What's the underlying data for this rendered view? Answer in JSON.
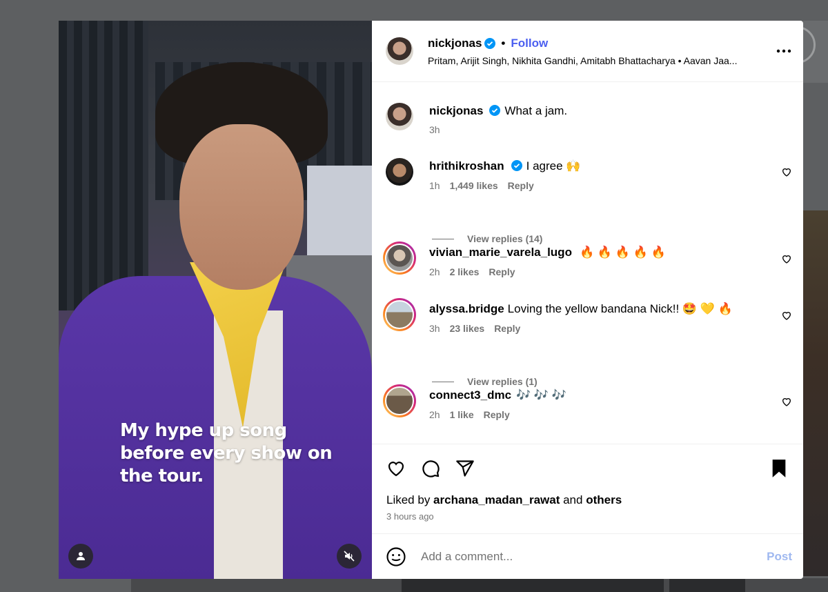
{
  "post": {
    "author": "nickjonas",
    "follow_label": "Follow",
    "dot": "•",
    "audio": "Pritam, Arijit Singh, Nikhita Gandhi, Amitabh Bhattacharya • Aavan Jaa...",
    "overlay_caption": "My hype up song before every show on the tour."
  },
  "caption": {
    "author": "nickjonas",
    "text": "What a jam.",
    "time": "3h"
  },
  "comments": [
    {
      "user": "hrithikroshan",
      "text": "I agree 🙌",
      "time": "1h",
      "likes": "1,449 likes",
      "reply": "Reply",
      "verified": true
    },
    {
      "user": "vivian_marie_varela_lugo",
      "text": "🔥 🔥 🔥 🔥 🔥",
      "time": "2h",
      "likes": "2 likes",
      "reply": "Reply",
      "verified": false
    },
    {
      "user": "alyssa.bridge",
      "text": "Loving the yellow bandana Nick!! 🤩 💛 🔥",
      "time": "3h",
      "likes": "23 likes",
      "reply": "Reply",
      "verified": false
    },
    {
      "user": "connect3_dmc",
      "text": "🎶 🎶 🎶",
      "time": "2h",
      "likes": "1 like",
      "reply": "Reply",
      "verified": false
    }
  ],
  "view_replies": [
    "View replies (14)",
    "View replies (1)"
  ],
  "likes": {
    "prefix": "Liked by ",
    "user": "archana_madan_rawat",
    "middle": " and ",
    "others": "others"
  },
  "posted_time": "3 hours ago",
  "add_comment": {
    "placeholder": "Add a comment...",
    "post_label": "Post"
  },
  "icons": {
    "verified": "verified-badge-icon",
    "more": "more-options-icon",
    "like": "heart-icon",
    "comment": "comment-icon",
    "share": "share-icon",
    "save": "bookmark-icon",
    "emoji": "emoji-icon",
    "user_tag": "user-tag-icon",
    "mute": "muted-speaker-icon"
  },
  "colors": {
    "follow": "#4b5ff0",
    "verified": "#0095f6",
    "secondary_text": "#737373",
    "post_disabled": "#9fb8f0"
  }
}
